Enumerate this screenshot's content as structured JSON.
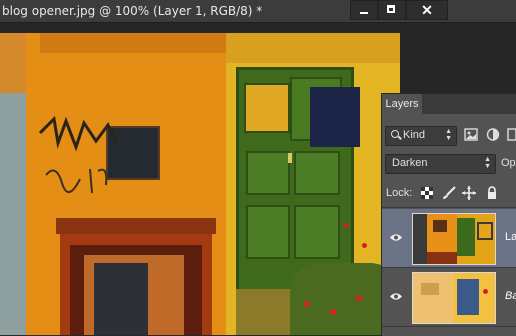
{
  "window": {
    "title": "blog opener.jpg @ 100% (Layer 1, RGB/8) *",
    "minimize_icon": "minimize-icon",
    "maximize_icon": "maximize-icon",
    "close_icon": "close-icon",
    "close_glyph": "✕"
  },
  "layers_panel": {
    "tab_label": "Layers",
    "filter": {
      "kind_label": "Kind",
      "icons": [
        "image-filter-icon",
        "adjustment-filter-icon",
        "type-filter-icon"
      ]
    },
    "blend_mode": "Darken",
    "opacity_label": "Op",
    "lock_label": "Lock:",
    "lock_icons": [
      "lock-transparent-pixels-icon",
      "lock-image-pixels-icon",
      "lock-position-icon",
      "lock-all-icon"
    ],
    "layers": [
      {
        "name": "Lay",
        "visible": true,
        "selected": true
      },
      {
        "name": "Ba",
        "visible": true,
        "selected": false
      }
    ]
  },
  "colors": {
    "panel_bg": "#535353",
    "selected_layer_bg": "#6b7487",
    "titlebar_bg": "#3c3c3c"
  }
}
